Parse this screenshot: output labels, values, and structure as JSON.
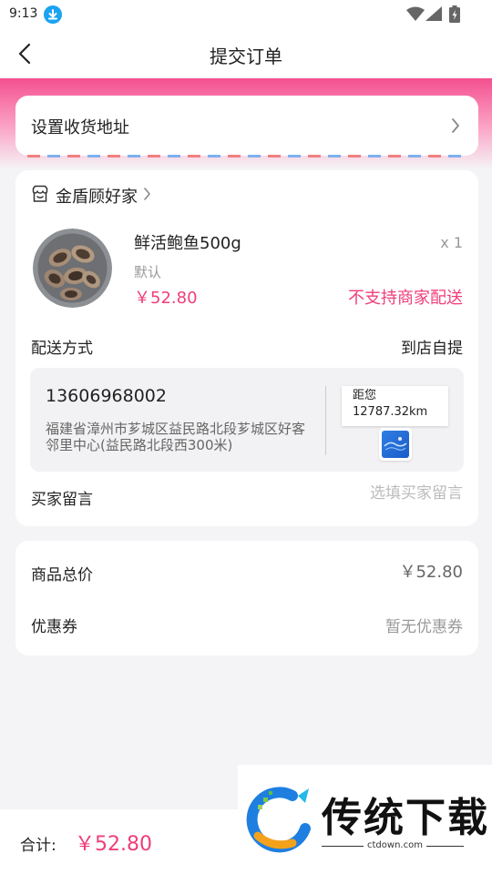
{
  "status_bar": {
    "time": "9:13"
  },
  "nav": {
    "title": "提交订单"
  },
  "address": {
    "label": "设置收货地址"
  },
  "store": {
    "name": "金盾顾好家"
  },
  "product": {
    "name": "鲜活鲍鱼500g",
    "quantity": "x 1",
    "spec": "默认",
    "price": "￥52.80",
    "delivery_warning": "不支持商家配送"
  },
  "delivery": {
    "label": "配送方式",
    "value": "到店自提"
  },
  "pickup": {
    "phone": "13606968002",
    "address": "福建省漳州市芗城区益民路北段芗城区好客邻里中心(益民路北段西300米)",
    "distance_label": "距您",
    "distance_value": "12787.32km"
  },
  "message": {
    "label": "买家留言",
    "placeholder": "选填买家留言"
  },
  "summary": {
    "total_label": "商品总价",
    "total_value": "￥52.80",
    "coupon_label": "优惠券",
    "coupon_value": "暂无优惠券"
  },
  "bottom": {
    "label": "合计:",
    "price": "￥52.80"
  },
  "watermark": {
    "brand": "传统下载",
    "site": "ctdown.com"
  },
  "colors": {
    "accent": "#ef3e7a",
    "band_top": "#f4508f"
  }
}
